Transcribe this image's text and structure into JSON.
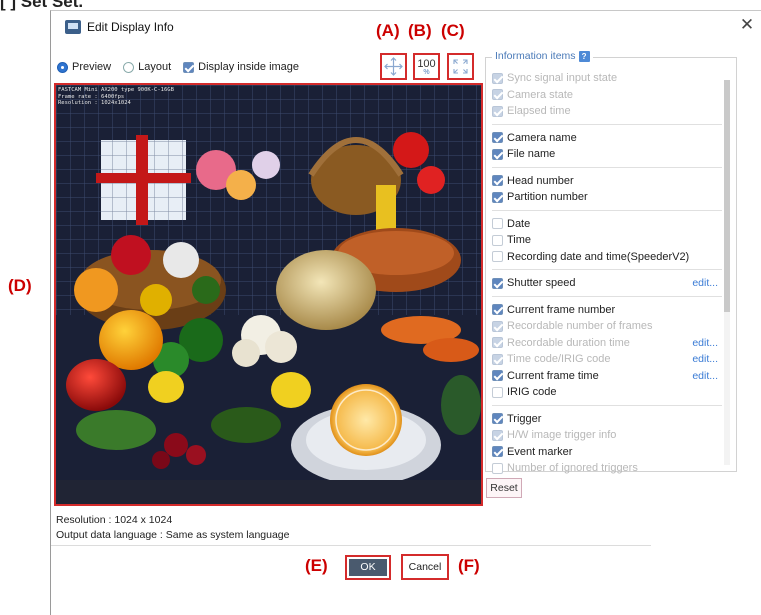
{
  "page": {
    "top_text": "[ ] Set Set."
  },
  "window": {
    "title": "Edit Display Info",
    "close_glyph": "✕"
  },
  "callouts": {
    "a": "(A)",
    "b": "(B)",
    "c": "(C)",
    "d": "(D)",
    "e": "(E)",
    "f": "(F)"
  },
  "view_options": {
    "preview_label": "Preview",
    "preview_selected": true,
    "layout_label": "Layout",
    "display_inside_label": "Display inside image",
    "display_inside_checked": true
  },
  "toolbar": {
    "move_icon": "move-arrows-icon",
    "zoom_value": "100",
    "zoom_unit": "%",
    "fit_icon": "fit-to-window-icon"
  },
  "image_overlay": {
    "line1": "FASTCAM Mini AX200 type 900K-C-16GB",
    "line2": "Frame rate : 6400fps",
    "line3": "Resolution : 1024x1024"
  },
  "info_items": {
    "header": "Information items",
    "help_glyph": "?",
    "groups": [
      [
        {
          "label": "Sync signal input state",
          "state": "disabled"
        },
        {
          "label": "Camera state",
          "state": "disabled"
        },
        {
          "label": "Elapsed time",
          "state": "disabled"
        }
      ],
      [
        {
          "label": "Camera name",
          "state": "checked"
        },
        {
          "label": "File name",
          "state": "checked"
        }
      ],
      [
        {
          "label": "Head number",
          "state": "checked"
        },
        {
          "label": "Partition number",
          "state": "checked"
        }
      ],
      [
        {
          "label": "Date",
          "state": "unchecked"
        },
        {
          "label": "Time",
          "state": "unchecked"
        },
        {
          "label": "Recording date and time(SpeederV2)",
          "state": "unchecked"
        }
      ],
      [
        {
          "label": "Shutter speed",
          "state": "checked",
          "edit": "edit..."
        }
      ],
      [
        {
          "label": "Current frame number",
          "state": "checked"
        },
        {
          "label": "Recordable number of frames",
          "state": "disabled"
        },
        {
          "label": "Recordable duration time",
          "state": "disabled",
          "edit": "edit..."
        },
        {
          "label": "Time code/IRIG code",
          "state": "disabled",
          "edit": "edit..."
        },
        {
          "label": "Current frame time",
          "state": "checked",
          "edit": "edit..."
        },
        {
          "label": "IRIG code",
          "state": "unchecked"
        }
      ],
      [
        {
          "label": "Trigger",
          "state": "checked"
        },
        {
          "label": "H/W image trigger info",
          "state": "disabled"
        },
        {
          "label": "Event marker",
          "state": "checked"
        },
        {
          "label": "Number of ignored triggers",
          "state": "disabled-unchecked"
        }
      ]
    ]
  },
  "reset_label": "Reset",
  "status": {
    "resolution": "Resolution : 1024 x 1024",
    "language": "Output data language : Same as system language"
  },
  "buttons": {
    "ok": "OK",
    "cancel": "Cancel"
  },
  "colors": {
    "callout_red": "#cc0000",
    "highlight_border": "#d42b2b",
    "link_blue": "#3a7bd5",
    "ok_fill": "#4a5a6e"
  }
}
